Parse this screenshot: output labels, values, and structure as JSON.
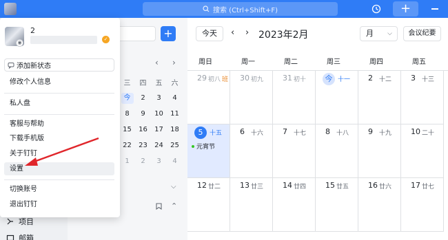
{
  "topbar": {
    "search_placeholder": "搜索 (Ctrl+Shift+F)",
    "add_label": "+"
  },
  "sidebar": {
    "items": [
      {
        "label": "项目"
      },
      {
        "label": "邮箱"
      }
    ]
  },
  "mini_calendar": {
    "add_label": "+",
    "weekday_headers": [
      "三",
      "四",
      "五",
      "六"
    ],
    "rows": [
      [
        {
          "label": "今",
          "state": "today"
        },
        {
          "label": "2",
          "state": ""
        },
        {
          "label": "3",
          "state": ""
        },
        {
          "label": "4",
          "state": ""
        }
      ],
      [
        {
          "label": "8",
          "state": ""
        },
        {
          "label": "9",
          "state": ""
        },
        {
          "label": "10",
          "state": ""
        },
        {
          "label": "11",
          "state": ""
        }
      ],
      [
        {
          "label": "15",
          "state": ""
        },
        {
          "label": "16",
          "state": ""
        },
        {
          "label": "17",
          "state": ""
        },
        {
          "label": "18",
          "state": ""
        }
      ],
      [
        {
          "label": "22",
          "state": ""
        },
        {
          "label": "23",
          "state": ""
        },
        {
          "label": "24",
          "state": ""
        },
        {
          "label": "25",
          "state": ""
        }
      ],
      [
        {
          "label": "1",
          "state": "dim"
        },
        {
          "label": "2",
          "state": "dim"
        },
        {
          "label": "3",
          "state": "dim"
        },
        {
          "label": "4",
          "state": "dim"
        }
      ]
    ]
  },
  "calendar": {
    "today_button": "今天",
    "title": "2023年2月",
    "view_select": "月",
    "meeting_notes_button": "会议纪要",
    "weekdays": [
      "周日",
      "周一",
      "周二",
      "周三",
      "周四",
      "周五"
    ],
    "weeks": [
      [
        {
          "day": "29",
          "lunar": "初八",
          "tag": "班",
          "style": "prev"
        },
        {
          "day": "30",
          "lunar": "初九",
          "tag": "",
          "style": "prev"
        },
        {
          "day": "31",
          "lunar": "初十",
          "tag": "",
          "style": "prev"
        },
        {
          "day": "今",
          "lunar": "十一",
          "tag": "",
          "style": "today"
        },
        {
          "day": "2",
          "lunar": "十二",
          "tag": "",
          "style": ""
        },
        {
          "day": "3",
          "lunar": "十三",
          "tag": "",
          "style": ""
        }
      ],
      [
        {
          "day": "5",
          "lunar": "十五",
          "tag": "",
          "style": "selected",
          "event": "元宵节"
        },
        {
          "day": "6",
          "lunar": "十六",
          "tag": "",
          "style": ""
        },
        {
          "day": "7",
          "lunar": "十七",
          "tag": "",
          "style": ""
        },
        {
          "day": "8",
          "lunar": "十八",
          "tag": "",
          "style": ""
        },
        {
          "day": "9",
          "lunar": "十九",
          "tag": "",
          "style": ""
        },
        {
          "day": "10",
          "lunar": "二十",
          "tag": "",
          "style": ""
        }
      ],
      [
        {
          "day": "12",
          "lunar": "廿二",
          "tag": "",
          "style": ""
        },
        {
          "day": "13",
          "lunar": "廿三",
          "tag": "",
          "style": ""
        },
        {
          "day": "14",
          "lunar": "廿四",
          "tag": "",
          "style": ""
        },
        {
          "day": "15",
          "lunar": "廿五",
          "tag": "",
          "style": ""
        },
        {
          "day": "16",
          "lunar": "廿六",
          "tag": "",
          "style": ""
        },
        {
          "day": "17",
          "lunar": "廿七",
          "tag": "",
          "style": ""
        }
      ]
    ]
  },
  "menu": {
    "user_name": "2",
    "status_button": "添加新状态",
    "items": [
      "修改个人信息",
      "私人盘",
      "客服与帮助",
      "下载手机版",
      "关于钉钉",
      "设置",
      "切换账号",
      "退出钉钉"
    ]
  },
  "colors": {
    "brand": "#2f7cf6",
    "annotation_arrow": "#e0262b",
    "holiday_tag": "#e98a2c",
    "event_dot": "#34c724"
  }
}
